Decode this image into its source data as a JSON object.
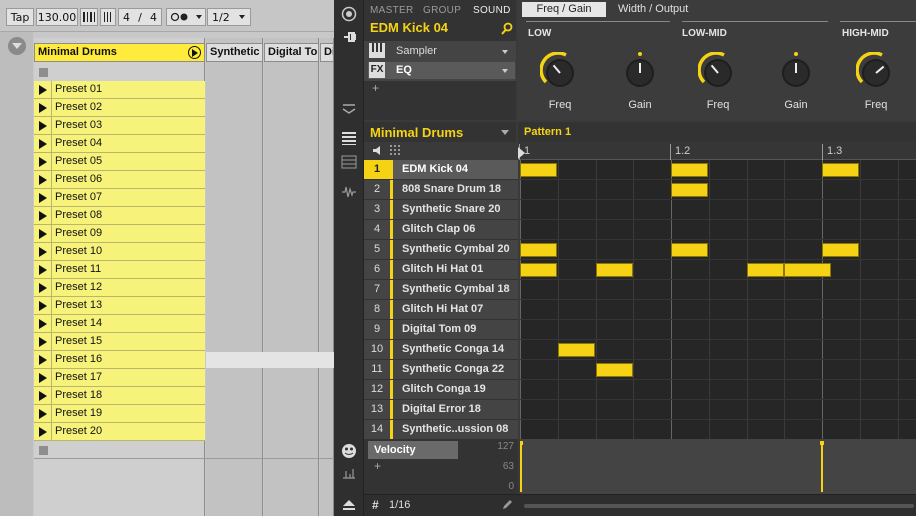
{
  "ableton": {
    "tap": "Tap",
    "tempo": "130.00",
    "signature_num": "4",
    "signature_sep": "/",
    "signature_den": "4",
    "quantize": "1/2",
    "tracks": {
      "minimal_drums": "Minimal Drums",
      "synthetic": "Synthetic",
      "digital_to": "Digital To",
      "di": "Di"
    },
    "presets": [
      "Preset 01",
      "Preset 02",
      "Preset 03",
      "Preset 04",
      "Preset 05",
      "Preset 06",
      "Preset 07",
      "Preset 08",
      "Preset 09",
      "Preset 10",
      "Preset 11",
      "Preset 12",
      "Preset 13",
      "Preset 14",
      "Preset 15",
      "Preset 16",
      "Preset 17",
      "Preset 18",
      "Preset 19",
      "Preset 20"
    ]
  },
  "maschine": {
    "tabs": {
      "master": "MASTER",
      "group": "GROUP",
      "sound": "SOUND"
    },
    "sound_title": "EDM Kick 04",
    "chain": {
      "sampler": "Sampler",
      "fx": "FX",
      "eq": "EQ",
      "add": "+"
    },
    "param_tabs": {
      "freq_gain": "Freq / Gain",
      "width_output": "Width / Output"
    },
    "bands": {
      "low": "LOW",
      "low_mid": "LOW-MID",
      "high_mid": "HIGH-MID"
    },
    "knob_labels": [
      "Freq",
      "Gain",
      "Freq",
      "Gain",
      "Freq"
    ],
    "group_title": "Minimal Drums",
    "pattern_name": "Pattern 1",
    "ruler": [
      "1",
      "1.2",
      "1.3"
    ],
    "sounds": [
      {
        "num": "1",
        "name": "EDM Kick 04"
      },
      {
        "num": "2",
        "name": "808 Snare Drum 18"
      },
      {
        "num": "3",
        "name": "Synthetic Snare 20"
      },
      {
        "num": "4",
        "name": "Glitch Clap 06"
      },
      {
        "num": "5",
        "name": "Synthetic Cymbal 20"
      },
      {
        "num": "6",
        "name": "Glitch Hi Hat 01"
      },
      {
        "num": "7",
        "name": "Synthetic Cymbal 18"
      },
      {
        "num": "8",
        "name": "Glitch Hi Hat 07"
      },
      {
        "num": "9",
        "name": "Digital Tom 09"
      },
      {
        "num": "10",
        "name": "Synthetic Conga 14"
      },
      {
        "num": "11",
        "name": "Synthetic Conga 22"
      },
      {
        "num": "12",
        "name": "Glitch Conga 19"
      },
      {
        "num": "13",
        "name": "Digital Error 18"
      },
      {
        "num": "14",
        "name": "Synthetic..ussion 08"
      }
    ],
    "velocity": {
      "label": "Velocity",
      "max": "127",
      "mid": "63",
      "min": "0",
      "add": "+"
    },
    "grid_division": "1/16",
    "colors": {
      "accent": "#f5d314",
      "preset_slot": "#f7f27a",
      "track_head": "#ffeb3b"
    }
  }
}
